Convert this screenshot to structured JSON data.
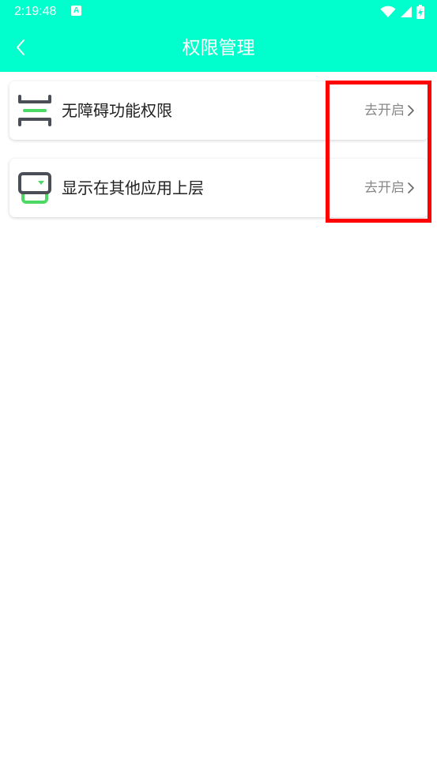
{
  "status_bar": {
    "time": "2:19:48",
    "notification_icon": "A",
    "icons": [
      "wifi-icon",
      "signal-icon",
      "battery-charging-icon"
    ]
  },
  "header": {
    "title": "权限管理",
    "back_icon": "chevron-left-icon"
  },
  "permissions": [
    {
      "label": "无障碍功能权限",
      "action": "去开启",
      "icon": "accessibility-icon"
    },
    {
      "label": "显示在其他应用上层",
      "action": "去开启",
      "icon": "overlay-window-icon"
    }
  ],
  "colors": {
    "accent": "#00ffcc",
    "icon_dark": "#4a4f57",
    "icon_green": "#4cd964",
    "highlight": "#ff0000"
  }
}
